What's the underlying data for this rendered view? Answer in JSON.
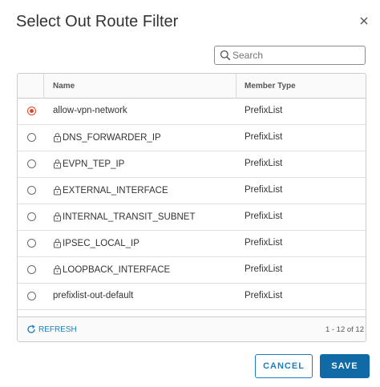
{
  "dialog": {
    "title": "Select Out Route Filter"
  },
  "search": {
    "placeholder": "Search",
    "value": ""
  },
  "table": {
    "columns": [
      "Name",
      "Member Type"
    ],
    "rows": [
      {
        "name": "allow-vpn-network",
        "type": "PrefixList",
        "selected": true,
        "locked": false
      },
      {
        "name": "DNS_FORWARDER_IP",
        "type": "PrefixList",
        "selected": false,
        "locked": true
      },
      {
        "name": "EVPN_TEP_IP",
        "type": "PrefixList",
        "selected": false,
        "locked": true
      },
      {
        "name": "EXTERNAL_INTERFACE",
        "type": "PrefixList",
        "selected": false,
        "locked": true
      },
      {
        "name": "INTERNAL_TRANSIT_SUBNET",
        "type": "PrefixList",
        "selected": false,
        "locked": true
      },
      {
        "name": "IPSEC_LOCAL_IP",
        "type": "PrefixList",
        "selected": false,
        "locked": true
      },
      {
        "name": "LOOPBACK_INTERFACE",
        "type": "PrefixList",
        "selected": false,
        "locked": true
      },
      {
        "name": "prefixlist-out-default",
        "type": "PrefixList",
        "selected": false,
        "locked": false
      }
    ]
  },
  "footer": {
    "refresh_label": "REFRESH",
    "pagination": "1 - 12 of 12"
  },
  "buttons": {
    "cancel_label": "CANCEL",
    "save_label": "SAVE"
  },
  "colors": {
    "accent": "#1b7fc0",
    "primary_button": "#0f6aa6",
    "radio_selected": "#d7492c"
  },
  "icons": {
    "close": "close-icon",
    "search": "search-icon",
    "lock": "lock-icon",
    "refresh": "refresh-icon"
  }
}
